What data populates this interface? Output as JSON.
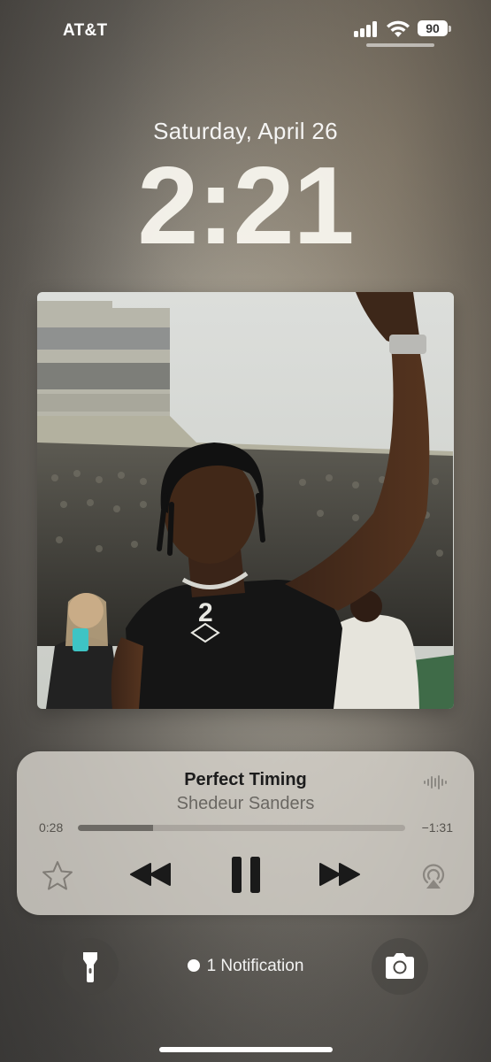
{
  "status_bar": {
    "carrier": "AT&T",
    "battery_level": "90",
    "signal_bars": 4,
    "wifi": true
  },
  "lock_screen": {
    "date": "Saturday, April 26",
    "time": "2:21"
  },
  "now_playing": {
    "title": "Perfect Timing",
    "artist": "Shedeur Sanders",
    "elapsed": "0:28",
    "remaining": "−1:31",
    "progress_fraction": 0.23,
    "controls": [
      "star-icon",
      "rewind-icon",
      "pause-icon",
      "fast-forward-icon",
      "airplay-icon"
    ],
    "waveform_icon": "waveform-icon"
  },
  "bottom": {
    "flashlight_icon": "flashlight-icon",
    "camera_icon": "camera-icon",
    "notification_text": "1 Notification"
  }
}
